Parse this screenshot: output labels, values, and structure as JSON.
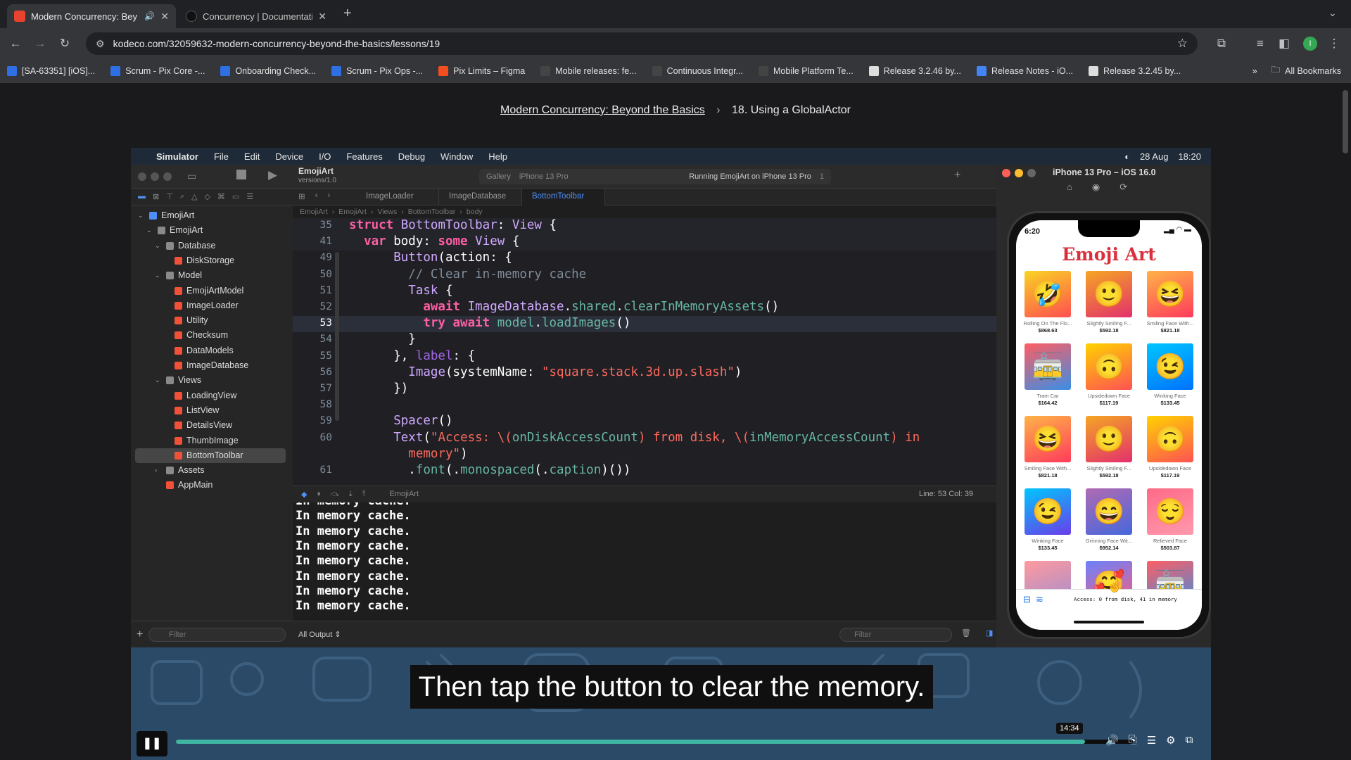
{
  "browser": {
    "tabs": [
      {
        "title": "Modern Concurrency: Bey",
        "active": true,
        "favicon_color": "#e8432e"
      },
      {
        "title": "Concurrency | Documentation",
        "active": false,
        "favicon_color": "#111111"
      }
    ],
    "url": "kodeco.com/32059632-modern-concurrency-beyond-the-basics/lessons/19",
    "bookmarks": [
      {
        "label": "[SA-63351] [iOS]...",
        "color": "#2f6fe4"
      },
      {
        "label": "Scrum - Pix Core -...",
        "color": "#2f6fe4"
      },
      {
        "label": "Onboarding Check...",
        "color": "#2f6fe4"
      },
      {
        "label": "Scrum - Pix Ops -...",
        "color": "#2f6fe4"
      },
      {
        "label": "Pix Limits – Figma",
        "color": "#f24e1e"
      },
      {
        "label": "Mobile releases: fe...",
        "color": "#444444"
      },
      {
        "label": "Continuous Integr...",
        "color": "#444444"
      },
      {
        "label": "Mobile Platform Te...",
        "color": "#444444"
      },
      {
        "label": "Release 3.2.46 by...",
        "color": "#dddddd"
      },
      {
        "label": "Release Notes - iO...",
        "color": "#4285f4"
      },
      {
        "label": "Release 3.2.45 by...",
        "color": "#dddddd"
      }
    ],
    "all_bookmarks": "All Bookmarks",
    "profile_initial": "I"
  },
  "page": {
    "breadcrumb_course": "Modern Concurrency: Beyond the Basics",
    "breadcrumb_sep": "›",
    "breadcrumb_lesson": "18. Using a GlobalActor"
  },
  "mac_menu": {
    "items": [
      "Simulator",
      "File",
      "Edit",
      "Device",
      "I/O",
      "Features",
      "Debug",
      "Window",
      "Help"
    ],
    "date": "28 Aug",
    "time": "18:20"
  },
  "xcode": {
    "project": "EmojiArt",
    "branch": "versions/1.0",
    "scheme": "Gallery",
    "device": "iPhone 13 Pro",
    "status": "Running EmojiArt on iPhone 13 Pro",
    "warnings": "1",
    "tabs": [
      "ImageLoader",
      "ImageDatabase",
      "BottomToolbar"
    ],
    "jumpbar": [
      "EmojiArt",
      "EmojiArt",
      "Views",
      "BottomToolbar",
      "body"
    ],
    "navigator": [
      {
        "label": "EmojiArt",
        "level": 0,
        "kind": "project"
      },
      {
        "label": "EmojiArt",
        "level": 1,
        "kind": "folder"
      },
      {
        "label": "Database",
        "level": 2,
        "kind": "folder"
      },
      {
        "label": "DiskStorage",
        "level": 3,
        "kind": "swift"
      },
      {
        "label": "Model",
        "level": 2,
        "kind": "folder"
      },
      {
        "label": "EmojiArtModel",
        "level": 3,
        "kind": "swift"
      },
      {
        "label": "ImageLoader",
        "level": 3,
        "kind": "swift"
      },
      {
        "label": "Utility",
        "level": 3,
        "kind": "swift"
      },
      {
        "label": "Checksum",
        "level": 3,
        "kind": "swift"
      },
      {
        "label": "DataModels",
        "level": 3,
        "kind": "swift"
      },
      {
        "label": "ImageDatabase",
        "level": 3,
        "kind": "swift"
      },
      {
        "label": "Views",
        "level": 2,
        "kind": "folder"
      },
      {
        "label": "LoadingView",
        "level": 3,
        "kind": "swift"
      },
      {
        "label": "ListView",
        "level": 3,
        "kind": "swift"
      },
      {
        "label": "DetailsView",
        "level": 3,
        "kind": "swift"
      },
      {
        "label": "ThumbImage",
        "level": 3,
        "kind": "swift"
      },
      {
        "label": "BottomToolbar",
        "level": 3,
        "kind": "swift",
        "selected": true
      },
      {
        "label": "Assets",
        "level": 2,
        "kind": "folder"
      },
      {
        "label": "AppMain",
        "level": 2,
        "kind": "swift"
      }
    ],
    "nav_filter_placeholder": "Filter",
    "code": [
      {
        "n": "35",
        "sticky": true,
        "html": "<span class='kw'>struct</span> <span class='ty'>BottomToolbar</span>: <span class='ty'>View</span> {"
      },
      {
        "n": "41",
        "sticky": true,
        "html": "  <span class='kw'>var</span> body: <span class='kw'>some</span> <span class='ty'>View</span> {"
      },
      {
        "n": "49",
        "html": "      <span class='ty'>Button</span>(action: {"
      },
      {
        "n": "50",
        "html": "        <span class='cm'>// Clear in-memory cache</span>"
      },
      {
        "n": "51",
        "html": "        <span class='ty'>Task</span> {"
      },
      {
        "n": "52",
        "html": "          <span class='kw'>await</span> <span class='ty'>ImageDatabase</span>.<span class='fn'>shared</span>.<span class='fn'>clearInMemoryAssets</span>()"
      },
      {
        "n": "53",
        "current": true,
        "html": "          <span class='kw'>try</span> <span class='kw'>await</span> <span class='fn'>model</span>.<span class='fn'>loadImages</span>()"
      },
      {
        "n": "54",
        "html": "        }"
      },
      {
        "n": "55",
        "html": "      }, <span class='pr'>label</span>: {"
      },
      {
        "n": "56",
        "html": "        <span class='ty'>Image</span>(systemName: <span class='st'>\"square.stack.3d.up.slash\"</span>)"
      },
      {
        "n": "57",
        "html": "      })"
      },
      {
        "n": "58",
        "html": ""
      },
      {
        "n": "59",
        "html": "      <span class='ty'>Spacer</span>()"
      },
      {
        "n": "60",
        "html": "      <span class='ty'>Text</span>(<span class='st'>\"Access: \\(</span><span class='fn'>onDiskAccessCount</span><span class='st'>) from disk, \\(</span><span class='fn'>inMemoryAccessCount</span><span class='st'>) in</span>"
      },
      {
        "n": "",
        "html": "        <span class='st'>memory\"</span>)"
      },
      {
        "n": "61",
        "html": "        .<span class='fn'>font</span>(.<span class='fn'>monospaced</span>(.<span class='fn'>caption</span>)())"
      }
    ],
    "cursor_position": "Line: 53  Col: 39",
    "debug_target": "EmojiArt",
    "console_lines": [
      "In memory cache.",
      "In memory cache.",
      "In memory cache.",
      "In memory cache.",
      "In memory cache.",
      "In memory cache.",
      "In memory cache.",
      "In memory cache."
    ],
    "output_selector": "All Output ⇕",
    "console_filter_placeholder": "Filter"
  },
  "simulator": {
    "title": "iPhone 13 Pro – iOS 16.0",
    "status_time": "6:20",
    "app_title": "Emoji Art",
    "footer_text": "Access: 0 from disk, 41 in memory",
    "tiles": [
      {
        "emoji": "🤣",
        "name": "Rolling On The Flo...",
        "price": "$868.63",
        "grad": [
          "#f9d423",
          "#ff4e50"
        ]
      },
      {
        "emoji": "🙂",
        "name": "Slightly Smiling F...",
        "price": "$592.18",
        "grad": [
          "#f5a623",
          "#e3306c"
        ]
      },
      {
        "emoji": "😆",
        "name": "Smiling Face With...",
        "price": "$821.18",
        "grad": [
          "#ffb347",
          "#ff3b5c"
        ]
      },
      {
        "emoji": "🚋",
        "name": "Tram Car",
        "price": "$164.42",
        "grad": [
          "#ff5e62",
          "#3a8ee6"
        ]
      },
      {
        "emoji": "🙃",
        "name": "Upsidedown Face",
        "price": "$117.19",
        "grad": [
          "#ffd200",
          "#ff5252"
        ]
      },
      {
        "emoji": "😉",
        "name": "Winking Face",
        "price": "$133.45",
        "grad": [
          "#00c6ff",
          "#0072ff"
        ]
      },
      {
        "emoji": "😆",
        "name": "Smiling Face With...",
        "price": "$821.18",
        "grad": [
          "#ffb347",
          "#ff3b5c"
        ]
      },
      {
        "emoji": "🙂",
        "name": "Slightly Smiling F...",
        "price": "$592.18",
        "grad": [
          "#f5a623",
          "#e3306c"
        ]
      },
      {
        "emoji": "🙃",
        "name": "Upsidedown Face",
        "price": "$117.19",
        "grad": [
          "#ffd200",
          "#ff5252"
        ]
      },
      {
        "emoji": "😉",
        "name": "Winking Face",
        "price": "$133.45",
        "grad": [
          "#00c6ff",
          "#6a3de8"
        ]
      },
      {
        "emoji": "😄",
        "name": "Grinning Face Wit...",
        "price": "$952.14",
        "grad": [
          "#b06ab3",
          "#4568dc"
        ]
      },
      {
        "emoji": "😌",
        "name": "Relieved Face",
        "price": "$503.87",
        "grad": [
          "#ff6a88",
          "#ff99ac"
        ]
      },
      {
        "emoji": "",
        "name": "",
        "price": "",
        "grad": [
          "#ff9a9e",
          "#a18cd1"
        ]
      },
      {
        "emoji": "🥰",
        "name": "",
        "price": "",
        "grad": [
          "#6a82fb",
          "#fc5c7d"
        ]
      },
      {
        "emoji": "🚋",
        "name": "",
        "price": "",
        "grad": [
          "#ff5e62",
          "#3a8ee6"
        ]
      }
    ]
  },
  "video": {
    "subtitle": "Then tap the button to clear the memory.",
    "time_tooltip": "14:34",
    "progress": 0.95,
    "accent": "#3fb5a3"
  }
}
